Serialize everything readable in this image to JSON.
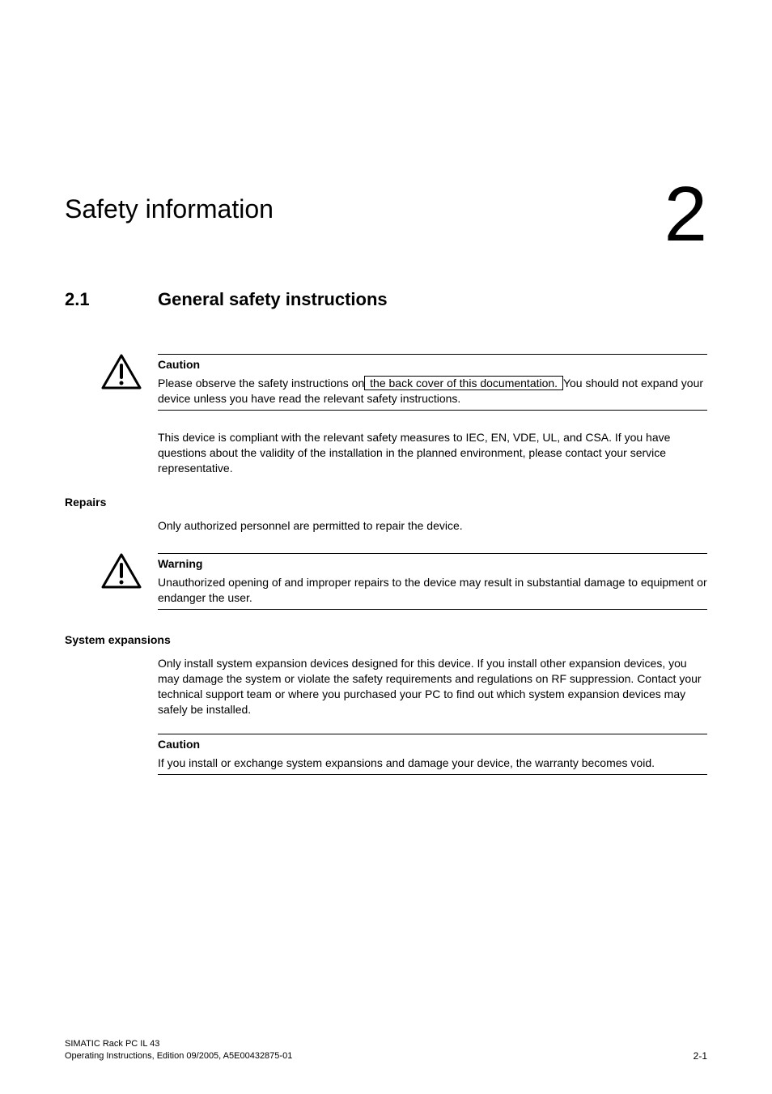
{
  "chapter": {
    "number": "2",
    "title": "Safety information"
  },
  "section": {
    "number": "2.1",
    "title": "General safety instructions"
  },
  "caution1": {
    "label": "Caution",
    "text_before": "Please observe the safety instructions on",
    "link_text": " the back cover of this documentation. ",
    "text_after": "You should not expand your device unless you have read the relevant safety instructions."
  },
  "compliance_text": "This device is compliant with the relevant safety measures to IEC, EN, VDE, UL, and CSA. If you have questions about the validity of the installation in the planned environment, please contact your service representative.",
  "repairs": {
    "heading": "Repairs",
    "text": "Only authorized personnel are permitted to repair the device."
  },
  "warning1": {
    "label": "Warning",
    "text": "Unauthorized opening of and improper repairs to the device may result in substantial damage to equipment or endanger the user."
  },
  "system_expansions": {
    "heading": "System expansions",
    "text": "Only install system expansion devices designed for this device. If you install other expansion devices, you may damage the system or violate the safety requirements and regulations on RF suppression. Contact your technical support team or where you purchased your PC to find out which system expansion devices may safely be installed."
  },
  "caution2": {
    "label": "Caution",
    "text": "If you install or exchange system expansions and damage your device, the warranty becomes void."
  },
  "footer": {
    "product": "SIMATIC Rack PC IL 43",
    "doc_info": "Operating Instructions, Edition 09/2005, A5E00432875-01",
    "page_number": "2-1"
  }
}
